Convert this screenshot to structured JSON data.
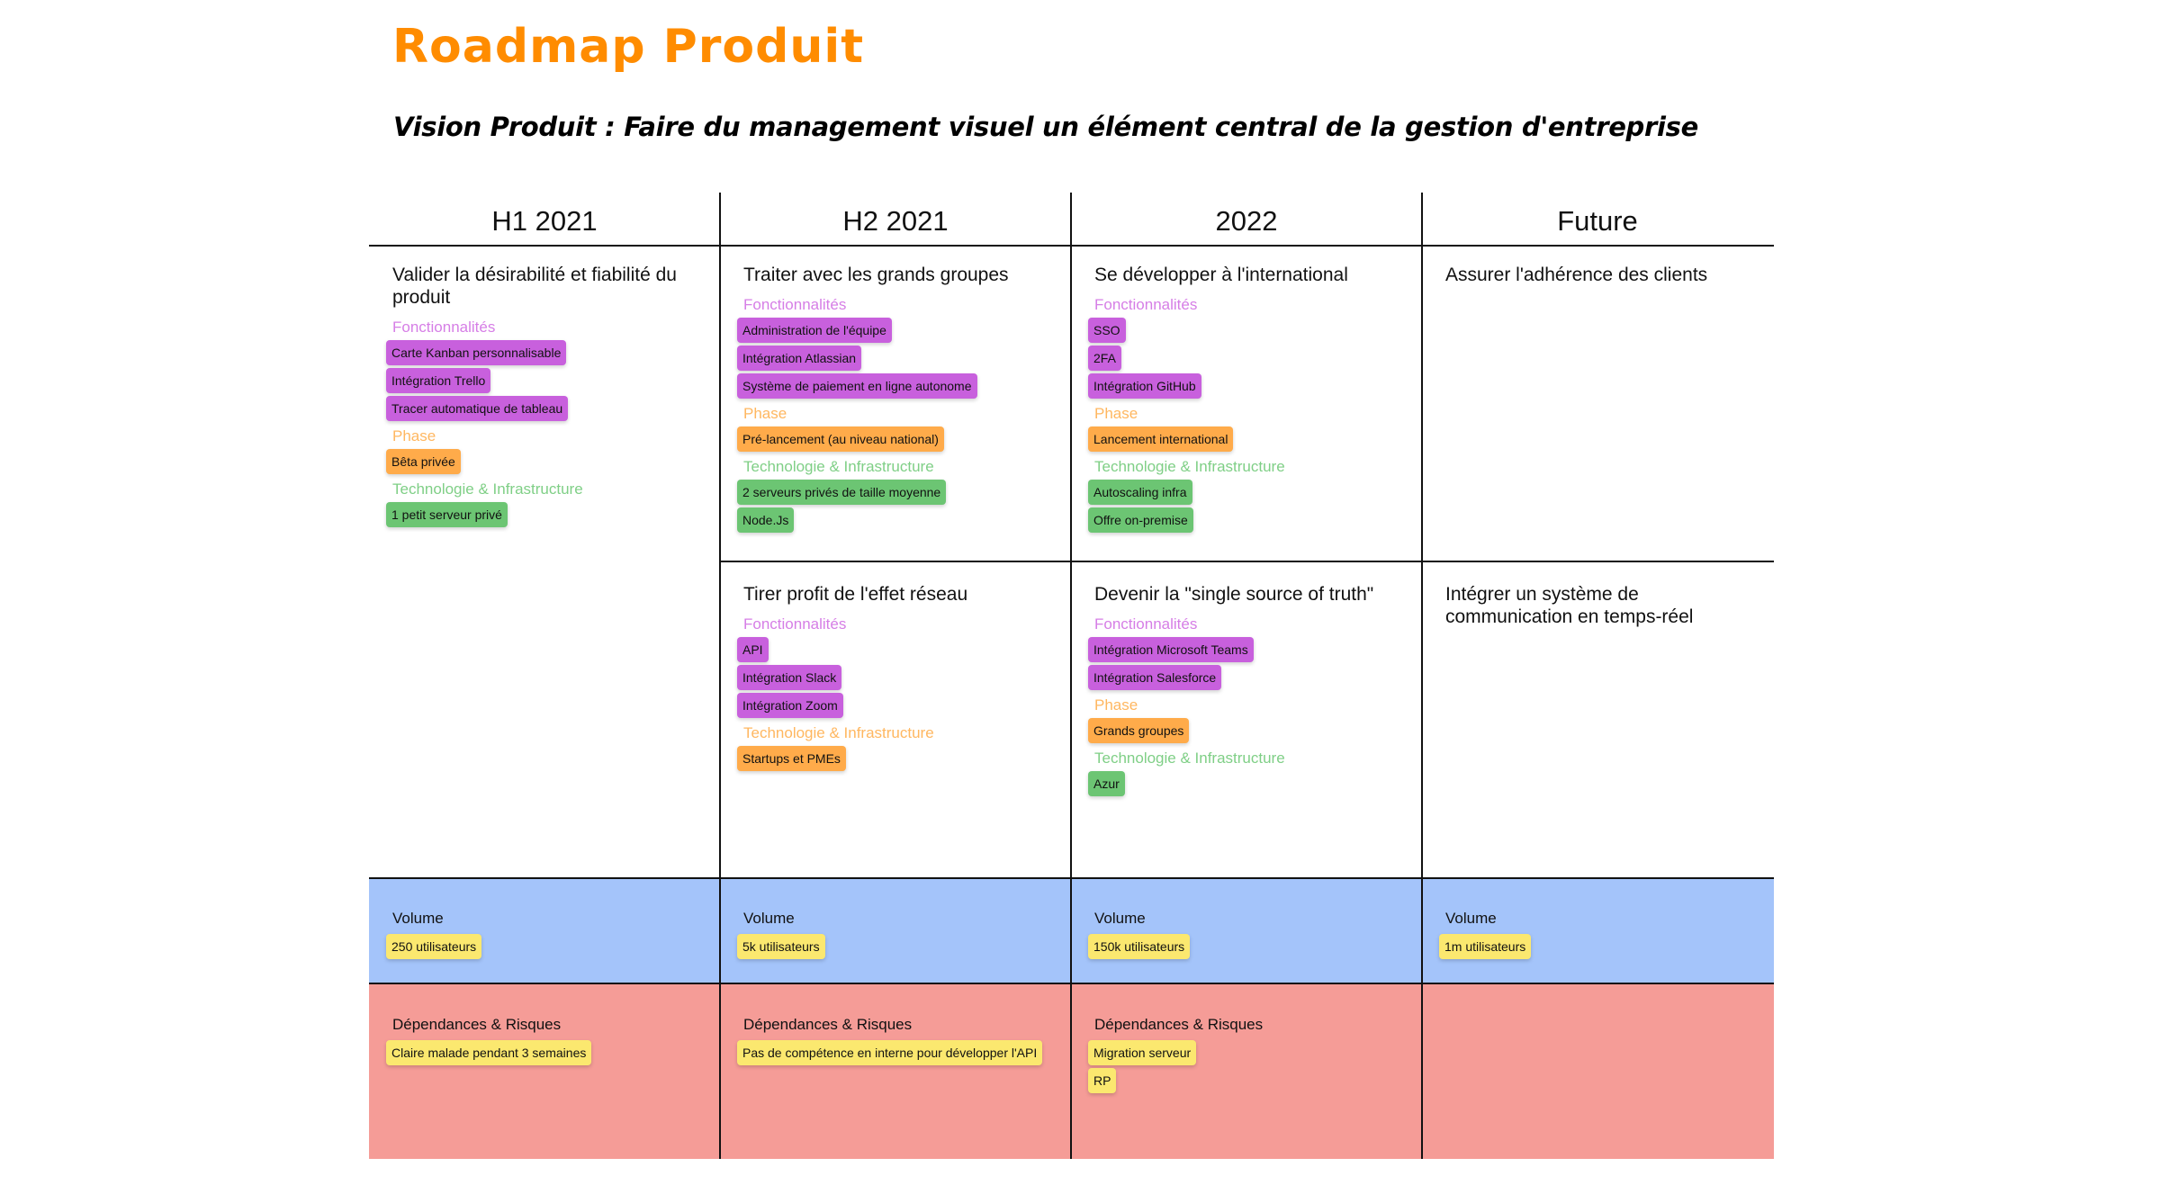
{
  "title": "Roadmap Produit",
  "subtitle": "Vision Produit : Faire du management visuel un élément central de la gestion d'entreprise",
  "colors": {
    "title": "#ff8c00",
    "features_tag": "#c860dd",
    "features_label": "#d67ee6",
    "phase_tag": "#ffab4a",
    "phase_label": "#ffb760",
    "tech_tag": "#6cc573",
    "tech_label": "#7fcf86",
    "volume_band": "#a4c4fa",
    "risks_band": "#f59c97",
    "sticky_tag": "#fbe86f"
  },
  "columns": [
    {
      "label": "H1 2021"
    },
    {
      "label": "H2 2021"
    },
    {
      "label": "2022"
    },
    {
      "label": "Future"
    }
  ],
  "cells": {
    "h1_top": {
      "title": "Valider la désirabilité et fiabilité du produit",
      "groups": [
        {
          "label": "Fonctionnalités",
          "items": [
            "Carte Kanban personnalisable",
            "Intégration Trello",
            "Tracer automatique de tableau"
          ]
        },
        {
          "label": "Phase",
          "items": [
            "Bêta privée"
          ]
        },
        {
          "label": "Technologie & Infrastructure",
          "items": [
            "1 petit serveur privé"
          ]
        }
      ]
    },
    "h2_top": {
      "title": "Traiter avec les grands groupes",
      "groups": [
        {
          "label": "Fonctionnalités",
          "items": [
            "Administration de l'équipe",
            "Intégration Atlassian",
            "Système de paiement en ligne autonome"
          ]
        },
        {
          "label": "Phase",
          "items": [
            "Pré-lancement (au niveau national)"
          ]
        },
        {
          "label": "Technologie & Infrastructure",
          "items": [
            "2 serveurs privés de taille moyenne",
            "Node.Js"
          ]
        }
      ]
    },
    "y2022_top": {
      "title": "Se développer à l'international",
      "groups": [
        {
          "label": "Fonctionnalités",
          "items": [
            "SSO",
            "2FA",
            "Intégration GitHub"
          ]
        },
        {
          "label": "Phase",
          "items": [
            "Lancement international"
          ]
        },
        {
          "label": "Technologie & Infrastructure",
          "items": [
            "Autoscaling infra",
            "Offre on-premise"
          ]
        }
      ]
    },
    "future_top": {
      "title": "Assurer l'adhérence des clients"
    },
    "h2_mid": {
      "title": "Tirer profit de l'effet réseau",
      "groups": [
        {
          "label": "Fonctionnalités",
          "items": [
            "API",
            "Intégration Slack",
            "Intégration Zoom"
          ]
        },
        {
          "label": "Technologie & Infrastructure",
          "items": [
            "Startups et PMEs"
          ]
        }
      ]
    },
    "y2022_mid": {
      "title": "Devenir la \"single source of truth\"",
      "groups": [
        {
          "label": "Fonctionnalités",
          "items": [
            "Intégration Microsoft Teams",
            "Intégration Salesforce"
          ]
        },
        {
          "label": "Phase",
          "items": [
            "Grands groupes"
          ]
        },
        {
          "label": "Technologie & Infrastructure",
          "items": [
            "Azur"
          ]
        }
      ]
    },
    "future_mid": {
      "title": "Intégrer un système de communication en temps-réel"
    }
  },
  "volume": {
    "label": "Volume",
    "values": [
      "250 utilisateurs",
      "5k utilisateurs",
      "150k utilisateurs",
      "1m utilisateurs"
    ]
  },
  "risks": {
    "label": "Dépendances & Risques",
    "h1": [
      "Claire malade pendant 3 semaines"
    ],
    "h2": [
      "Pas de compétence en interne pour développer l'API"
    ],
    "y2022": [
      "Migration serveur",
      "RP"
    ]
  }
}
